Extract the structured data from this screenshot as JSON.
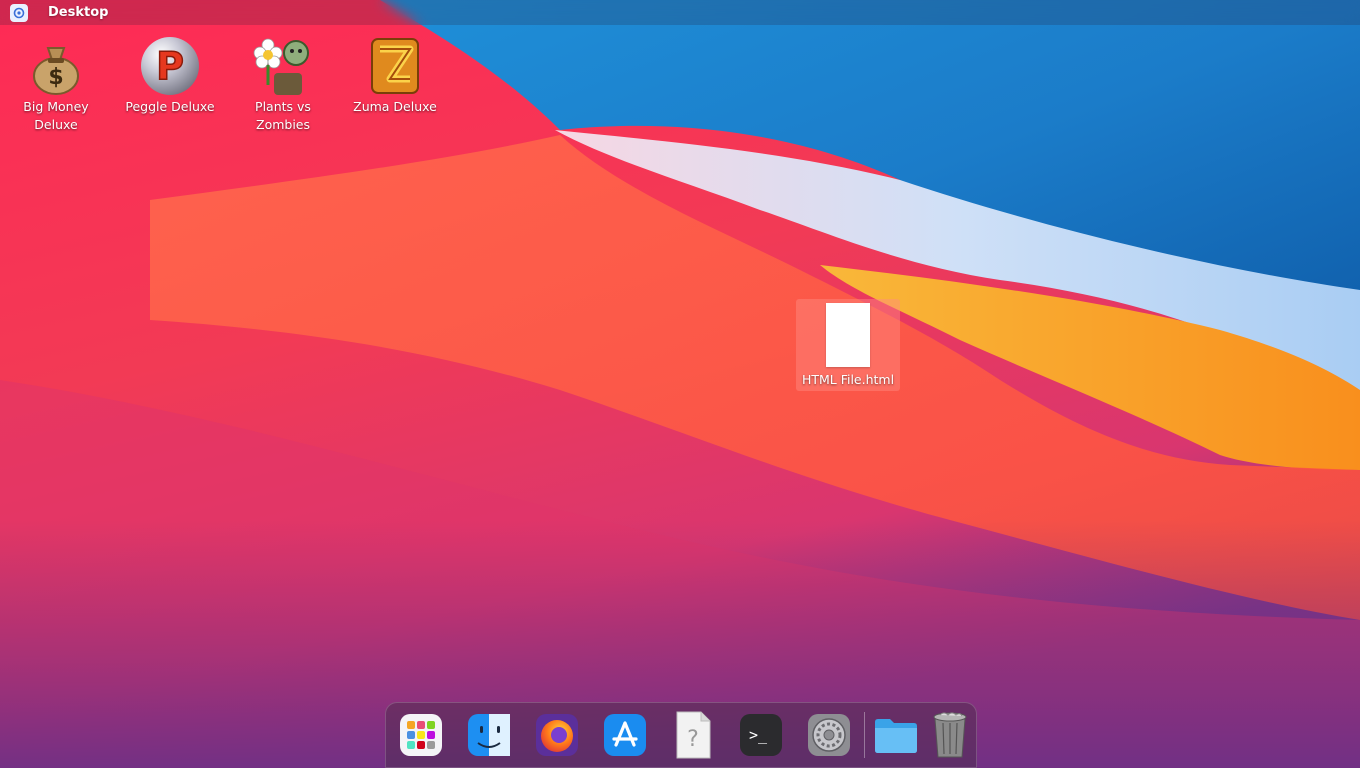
{
  "topbar": {
    "title": "Desktop",
    "logo_icon": "launcher-logo-icon"
  },
  "desktop_icons": [
    {
      "label": "Big Money Deluxe",
      "icon": "money-bag-icon"
    },
    {
      "label": "Peggle Deluxe",
      "icon": "peggle-ball-icon"
    },
    {
      "label": "Plants vs Zombies",
      "icon": "flower-zombie-icon"
    },
    {
      "label": "Zuma Deluxe",
      "icon": "zuma-frog-icon"
    }
  ],
  "selected_file": {
    "label": "HTML File.html",
    "icon": "blank-document-icon"
  },
  "dock": {
    "items": [
      {
        "name": "launchpad",
        "icon": "launchpad-grid-icon"
      },
      {
        "name": "finder",
        "icon": "finder-face-icon"
      },
      {
        "name": "firefox",
        "icon": "firefox-icon"
      },
      {
        "name": "app-store",
        "icon": "app-store-icon"
      },
      {
        "name": "unknown-file",
        "icon": "question-document-icon"
      },
      {
        "name": "terminal",
        "icon": "terminal-icon"
      },
      {
        "name": "system-preferences",
        "icon": "gear-icon"
      },
      {
        "name": "folder",
        "icon": "folder-icon"
      },
      {
        "name": "trash",
        "icon": "trash-icon"
      }
    ]
  },
  "colors": {
    "wallpaper_red": "#f0264f",
    "wallpaper_blue": "#1a73c8",
    "wallpaper_orange": "#f9a21f",
    "wallpaper_purple": "#7a2d7a"
  }
}
